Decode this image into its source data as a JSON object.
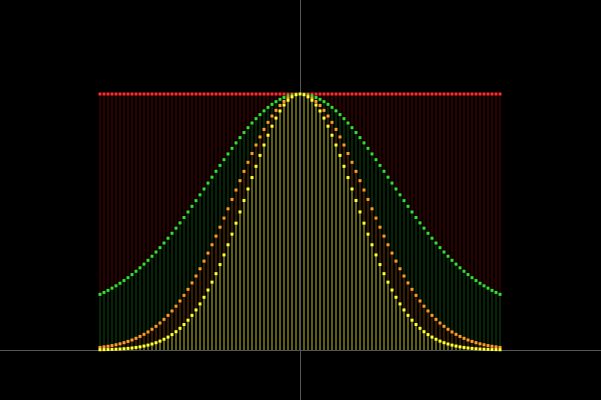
{
  "chart_data": {
    "type": "scatter",
    "title": "",
    "xlabel": "",
    "ylabel": "",
    "grid": false,
    "legend": "none",
    "xlim": [
      -1,
      1
    ],
    "ylim": [
      0,
      1
    ],
    "x_points": 101,
    "series": [
      {
        "color": "#ff2a2a",
        "stem_color": "#5a0000",
        "formula": "constant",
        "values_desc": "flat at 1.0"
      },
      {
        "color": "#33dd33",
        "stem_color": "#0c4a0c",
        "formula": "gaussian",
        "sigma": 0.45,
        "base": 0.145,
        "peak": 1.0
      },
      {
        "color": "#ff9a2a",
        "stem_color": "#6a3a00",
        "formula": "gaussian",
        "sigma": 0.33,
        "base": 0.0,
        "peak": 1.0
      },
      {
        "color": "#ffff33",
        "stem_color": "#bbbb22",
        "formula": "gaussian",
        "sigma": 0.27,
        "base": 0.0,
        "peak": 1.0
      }
    ],
    "colors": {
      "background": "#000000",
      "axis": "#555555"
    }
  }
}
